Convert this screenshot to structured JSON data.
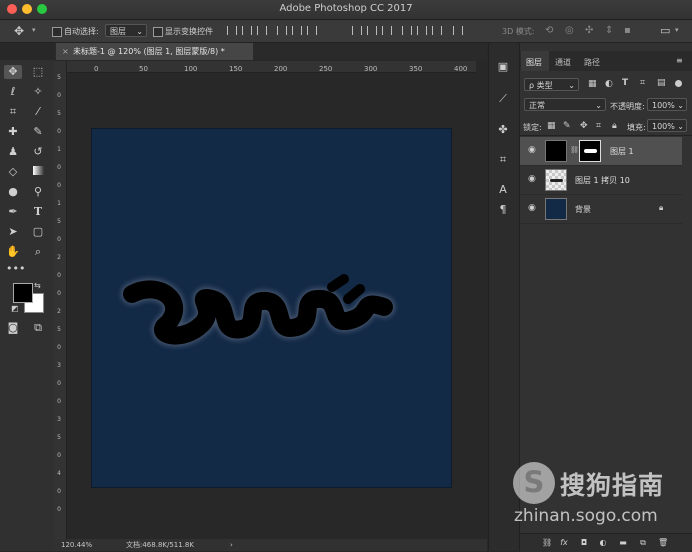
{
  "app": {
    "title": "Adobe Photoshop CC 2017",
    "traffic_light_colors": [
      "#fc5f57",
      "#fdbc2e",
      "#28c840"
    ]
  },
  "options_bar": {
    "auto_select_label": "自动选择:",
    "auto_select_target": "图层",
    "show_transform_label": "显示变换控件",
    "mode_3d_label": "3D 模式:"
  },
  "document": {
    "tab_title": "未标题-1 @ 120% (图层 1, 图层蒙版/8) *",
    "canvas_color": "#132a47",
    "ruler_top_labels": [
      "0",
      "50",
      "100",
      "150",
      "200",
      "250",
      "300",
      "350",
      "400"
    ],
    "ruler_left_labels": [
      "5",
      "0",
      "5",
      "0",
      "1",
      "0",
      "0",
      "1",
      "5",
      "0",
      "2",
      "0",
      "0",
      "2",
      "5",
      "0",
      "3",
      "0",
      "0",
      "3",
      "5",
      "0",
      "4",
      "0",
      "0"
    ]
  },
  "status_bar": {
    "zoom": "120.44%",
    "doc_size": "文档:468.8K/511.8K",
    "arrow": "›"
  },
  "layers_panel": {
    "tabs": [
      {
        "label": "图层",
        "active": true
      },
      {
        "label": "通道",
        "active": false
      },
      {
        "label": "路径",
        "active": false
      }
    ],
    "filter_kind": "ρ 类型",
    "blend_mode": "正常",
    "opacity_label": "不透明度:",
    "opacity_value": "100%",
    "lock_label": "锁定:",
    "fill_label": "填充:",
    "fill_value": "100%",
    "layers": [
      {
        "name": "图层 1",
        "selected": true,
        "has_mask": true,
        "locked": false
      },
      {
        "name": "图层 1 拷贝 10",
        "selected": false,
        "has_mask": false,
        "locked": false
      },
      {
        "name": "背景",
        "selected": false,
        "has_mask": false,
        "locked": true
      }
    ],
    "bottom_fx": "fx"
  },
  "watermark": {
    "brand": "搜狗指南",
    "url": "zhinan.sogo.com",
    "logo_letter": "S"
  }
}
